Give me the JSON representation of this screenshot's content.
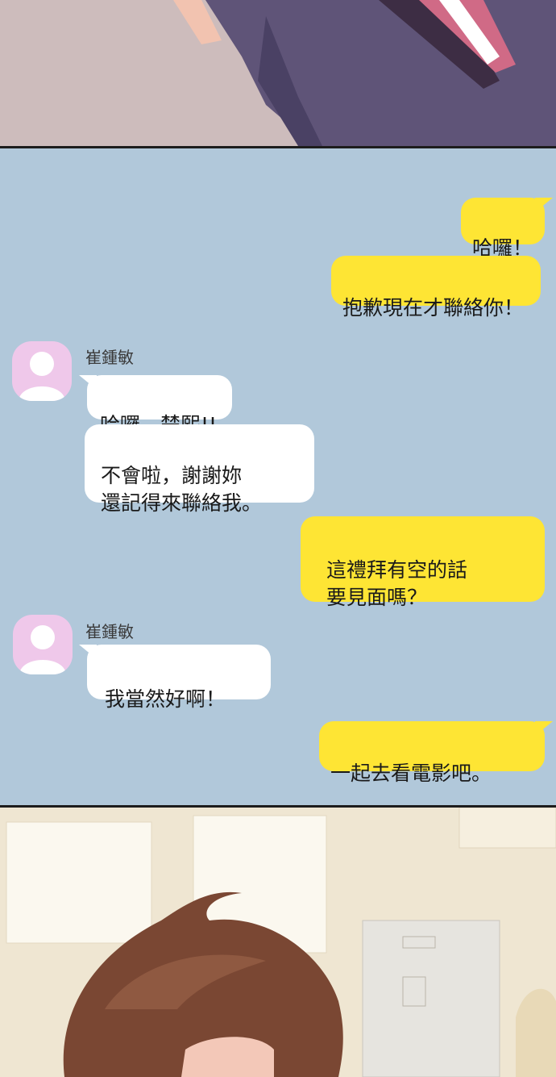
{
  "chat": {
    "messages": [
      {
        "from": "me",
        "text": "哈囉！"
      },
      {
        "from": "me",
        "text": "抱歉現在才聯絡你！"
      },
      {
        "from": "them",
        "sender": "崔鍾敏",
        "text": "哈囉，楚熙!!"
      },
      {
        "from": "them",
        "text": "不會啦，謝謝妳\n還記得來聯絡我。"
      },
      {
        "from": "me",
        "text": "這禮拜有空的話\n要見面嗎？"
      },
      {
        "from": "them",
        "sender": "崔鍾敏",
        "text": "我當然好啊！"
      },
      {
        "from": "me",
        "text": "一起去看電影吧。"
      }
    ]
  },
  "colors": {
    "chat_background": "#b1c8da",
    "my_bubble": "#fee534",
    "their_bubble": "#ffffff",
    "avatar_background": "#efc8ea"
  }
}
